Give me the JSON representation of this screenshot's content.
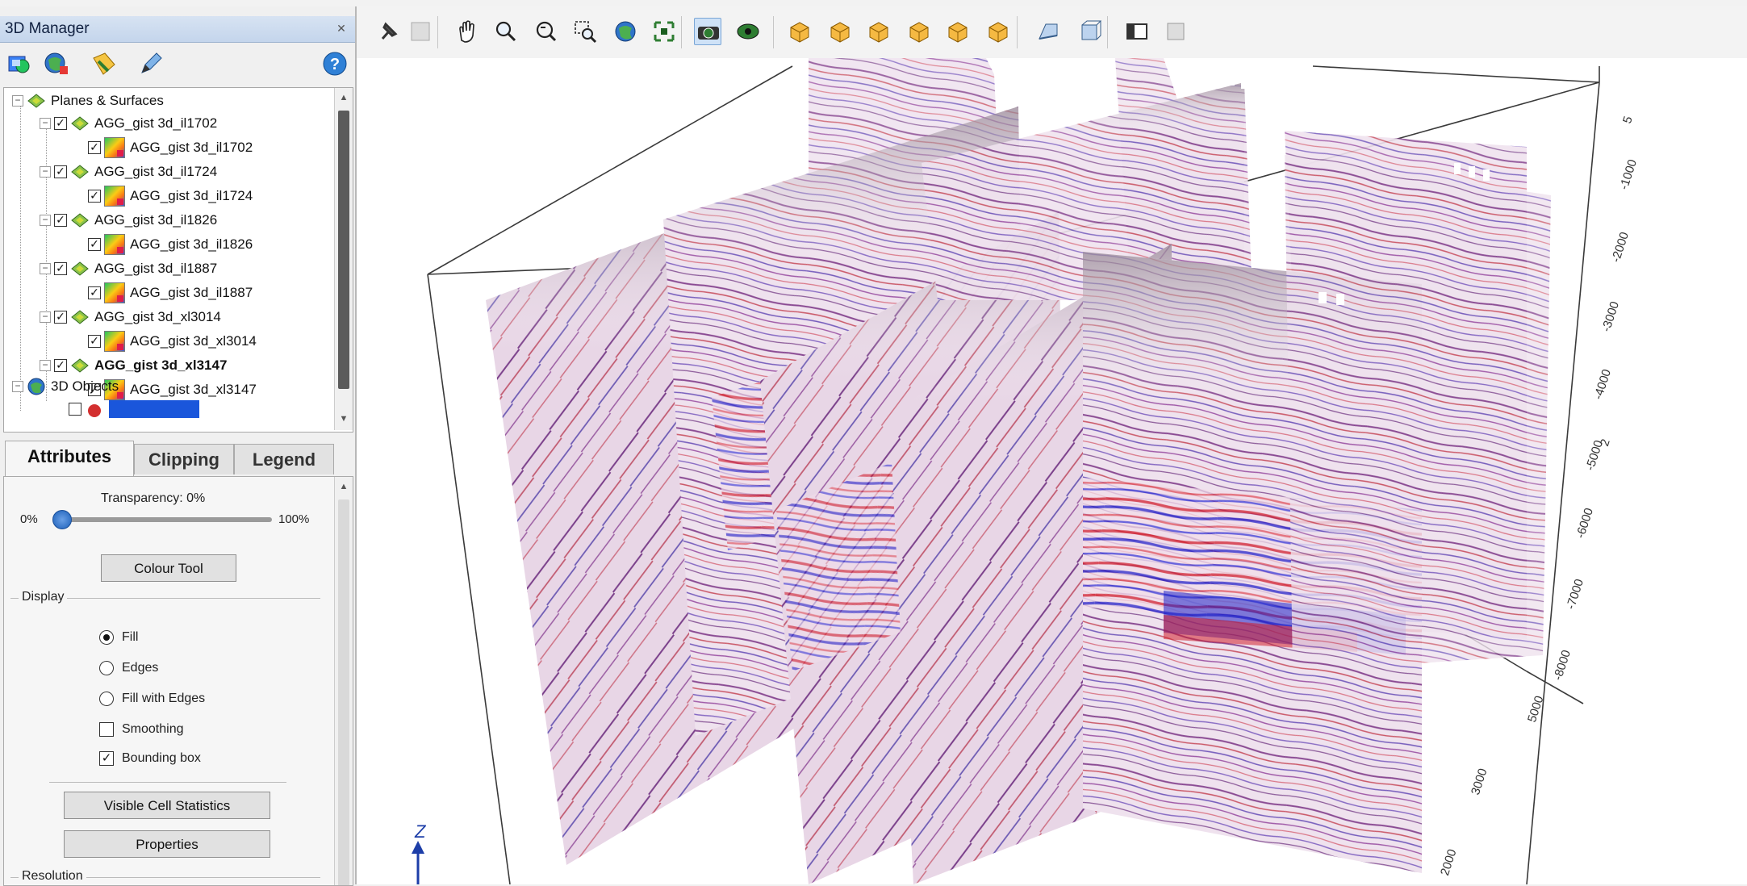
{
  "panel": {
    "title": "3D Manager",
    "close_glyph": "✕",
    "toolbar_icons": [
      "add-layer-icon",
      "globe-layers-icon",
      "tag-icon",
      "pencil-icon",
      "help-icon"
    ],
    "tree": {
      "root_planes": "Planes & Surfaces",
      "items": [
        {
          "group": "AGG_gist 3d_il1702",
          "child": "AGG_gist 3d_il1702",
          "bold": false
        },
        {
          "group": "AGG_gist 3d_il1724",
          "child": "AGG_gist 3d_il1724",
          "bold": false
        },
        {
          "group": "AGG_gist 3d_il1826",
          "child": "AGG_gist 3d_il1826",
          "bold": false
        },
        {
          "group": "AGG_gist 3d_il1887",
          "child": "AGG_gist 3d_il1887",
          "bold": false
        },
        {
          "group": "AGG_gist 3d_xl3014",
          "child": "AGG_gist 3d_xl3014",
          "bold": false
        },
        {
          "group": "AGG_gist 3d_xl3147",
          "child": "AGG_gist 3d_xl3147",
          "bold": true
        }
      ],
      "root_objects": "3D Objects",
      "check_mark": "✓",
      "collapse_glyph": "−"
    },
    "tabs": {
      "attributes": "Attributes",
      "clipping": "Clipping",
      "legend": "Legend",
      "active": "Attributes"
    },
    "attributes": {
      "transparency_label": "Transparency: 0%",
      "transparency_value": 0,
      "min_label": "0%",
      "max_label": "100%",
      "colour_tool": "Colour Tool",
      "display_group": "Display",
      "options": {
        "fill": "Fill",
        "edges": "Edges",
        "fill_with_edges": "Fill with Edges"
      },
      "selected_option": "Fill",
      "smoothing": "Smoothing",
      "smoothing_checked": false,
      "bounding_box": "Bounding box",
      "bounding_box_checked": true,
      "visible_cell_statistics": "Visible Cell Statistics",
      "properties": "Properties",
      "resolution_group": "Resolution"
    }
  },
  "toolbar": {
    "icons": [
      "pin-icon",
      "grid-icon",
      "hand-icon",
      "zoom-icon",
      "rotate-zoom-icon",
      "zoom-window-icon",
      "globe-icon",
      "fit-all-icon",
      "camera-icon",
      "eye-icon",
      "view-cube-1-icon",
      "view-cube-2-icon",
      "view-cube-3-icon",
      "view-cube-4-icon",
      "view-cube-5-icon",
      "view-cube-6-icon",
      "perspective-icon",
      "orthographic-icon",
      "panel-icon",
      "square-icon"
    ]
  },
  "viewport": {
    "axis_label": "Z",
    "z_ticks": [
      "5",
      "-1000",
      "-2000",
      "-3000",
      "-4000",
      "2",
      "-5000",
      "-6000",
      "-7000",
      "-8000"
    ],
    "y_ticks": [
      "5000",
      "3000",
      "2000"
    ]
  }
}
